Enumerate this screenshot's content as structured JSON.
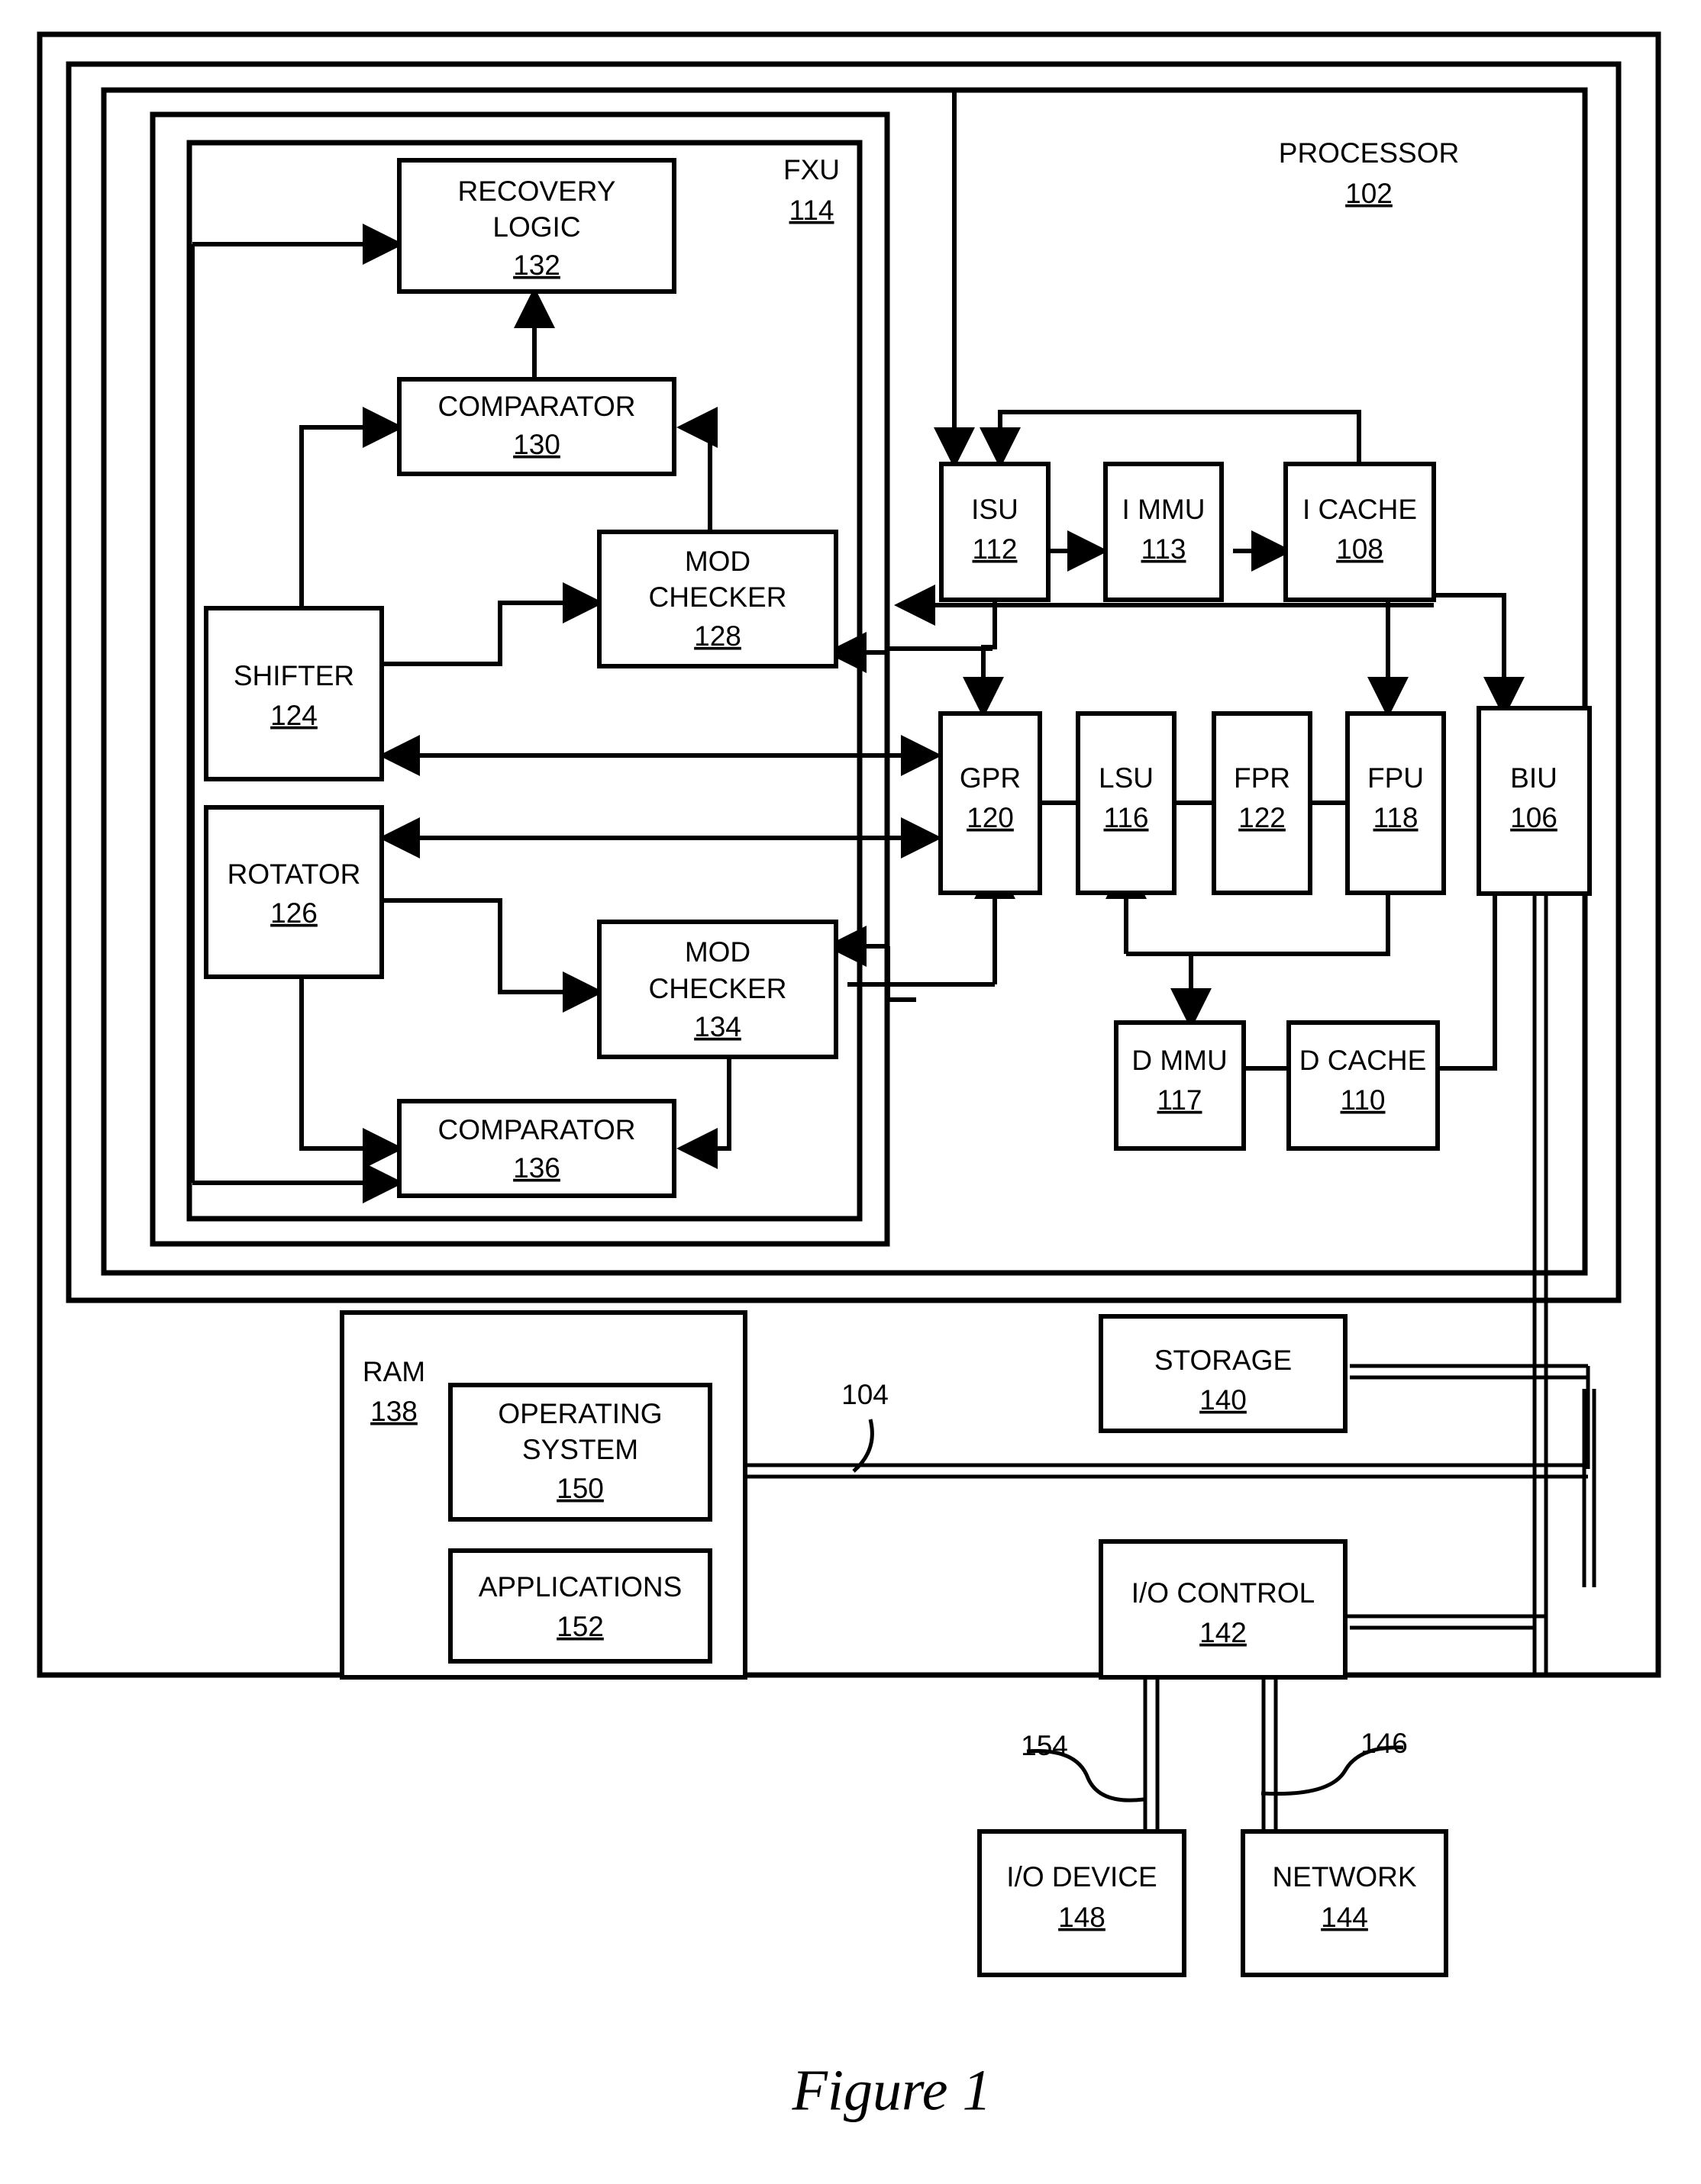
{
  "figure": {
    "caption": "Figure 1"
  },
  "frames": {
    "processor": {
      "label": "PROCESSOR",
      "ref": "102"
    },
    "fxu": {
      "label": "FXU",
      "ref": "114"
    }
  },
  "bus": {
    "ref": "104"
  },
  "leads": [
    {
      "ref": "154"
    },
    {
      "ref": "146"
    }
  ],
  "blocks": {
    "recovery_logic": {
      "line1": "RECOVERY",
      "line2": "LOGIC",
      "ref": "132"
    },
    "comparator_130": {
      "line1": "COMPARATOR",
      "ref": "130"
    },
    "mod_checker_128": {
      "line1": "MOD",
      "line2": "CHECKER",
      "ref": "128"
    },
    "shifter": {
      "line1": "SHIFTER",
      "ref": "124"
    },
    "rotator": {
      "line1": "ROTATOR",
      "ref": "126"
    },
    "mod_checker_134": {
      "line1": "MOD",
      "line2": "CHECKER",
      "ref": "134"
    },
    "comparator_136": {
      "line1": "COMPARATOR",
      "ref": "136"
    },
    "isu": {
      "line1": "ISU",
      "ref": "112"
    },
    "immu": {
      "line1": "I MMU",
      "ref": "113"
    },
    "icache": {
      "line1": "I CACHE",
      "ref": "108"
    },
    "gpr": {
      "line1": "GPR",
      "ref": "120"
    },
    "lsu": {
      "line1": "LSU",
      "ref": "116"
    },
    "fpr": {
      "line1": "FPR",
      "ref": "122"
    },
    "fpu": {
      "line1": "FPU",
      "ref": "118"
    },
    "biu": {
      "line1": "BIU",
      "ref": "106"
    },
    "dmmu": {
      "line1": "D MMU",
      "ref": "117"
    },
    "dcache": {
      "line1": "D CACHE",
      "ref": "110"
    },
    "ram": {
      "line1": "RAM",
      "ref": "138"
    },
    "operating_system": {
      "line1": "OPERATING",
      "line2": "SYSTEM",
      "ref": "150"
    },
    "applications": {
      "line1": "APPLICATIONS",
      "ref": "152"
    },
    "storage": {
      "line1": "STORAGE",
      "ref": "140"
    },
    "io_control": {
      "line1": "I/O CONTROL",
      "ref": "142"
    },
    "io_device": {
      "line1": "I/O DEVICE",
      "ref": "148"
    },
    "network": {
      "line1": "NETWORK",
      "ref": "144"
    }
  },
  "colors": {
    "ink": "#000000",
    "paper": "#ffffff"
  }
}
